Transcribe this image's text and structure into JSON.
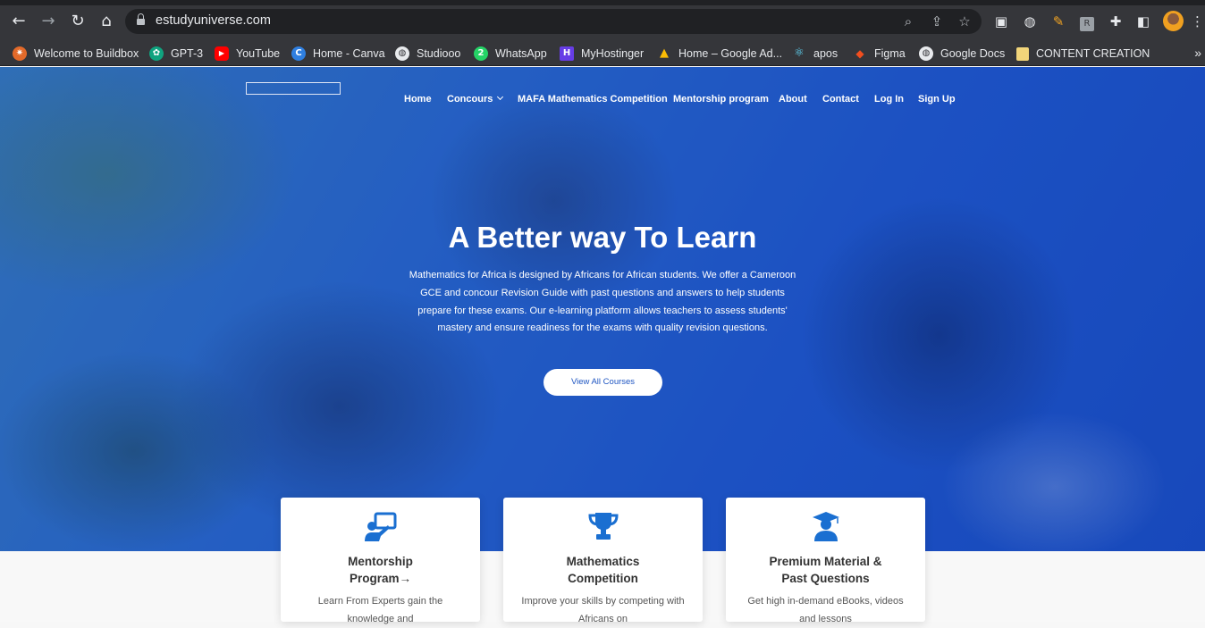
{
  "browser": {
    "url": "estudyuniverse.com",
    "bookmarks": [
      {
        "label": "Welcome to Buildbox",
        "icon": "buildbox-icon",
        "color": "#e36a2a",
        "glyph": "✷"
      },
      {
        "label": "GPT-3",
        "icon": "openai-icon",
        "color": "#10a37f",
        "glyph": "✿"
      },
      {
        "label": "YouTube",
        "icon": "youtube-icon",
        "color": "#ff0000",
        "glyph": "▶"
      },
      {
        "label": "Home - Canva",
        "icon": "canva-icon",
        "color": "#2f7fe0",
        "glyph": "C"
      },
      {
        "label": "Studiooo",
        "icon": "globe-icon",
        "color": "#5f6368",
        "glyph": "◍"
      },
      {
        "label": "WhatsApp",
        "icon": "whatsapp-icon",
        "color": "#25d366",
        "glyph": "2"
      },
      {
        "label": "MyHostinger",
        "icon": "hostinger-icon",
        "color": "#673de6",
        "glyph": "H"
      },
      {
        "label": "Home – Google Ad...",
        "icon": "google-ads-icon",
        "color": "#fbbc04",
        "glyph": "▲"
      },
      {
        "label": "apos",
        "icon": "react-icon",
        "color": "#35363a",
        "glyph": "⚛"
      },
      {
        "label": "Figma",
        "icon": "figma-icon",
        "color": "#f24e1e",
        "glyph": "◆"
      },
      {
        "label": "Google Docs",
        "icon": "globe-icon",
        "color": "#5f6368",
        "glyph": "◍"
      },
      {
        "label": "CONTENT CREATION",
        "icon": "folder-icon",
        "color": "#f2d57a",
        "glyph": ""
      }
    ],
    "more": "»"
  },
  "site": {
    "menu": [
      "Home",
      "Concours",
      "MAFA Mathematics Competition",
      "Mentorship program",
      "About",
      "Contact",
      "Log In",
      "Sign Up"
    ],
    "hero": {
      "title": "A Better way To Learn",
      "text": "Mathematics for Africa is designed by Africans for African students. We offer a Cameroon GCE and concour Revision Guide with past questions and answers to help students prepare for these exams. Our e-learning platform allows teachers to assess students' mastery and ensure readiness for the exams with quality revision questions.",
      "cta": "View All Courses"
    },
    "cards": [
      {
        "title_line1": "Mentorship",
        "title_line2": "Program",
        "desc": "Learn From Experts gain the knowledge and",
        "icon": "mentor-board-icon"
      },
      {
        "title_line1": "Mathematics",
        "title_line2": "Competition",
        "desc": "Improve your skills by competing with Africans on",
        "icon": "trophy-icon"
      },
      {
        "title_line1": "Premium Material &",
        "title_line2": "Past Questions",
        "desc": "Get high in-demand eBooks, videos and lessons",
        "icon": "graduate-icon"
      }
    ],
    "accent": "#1a6fd1"
  }
}
